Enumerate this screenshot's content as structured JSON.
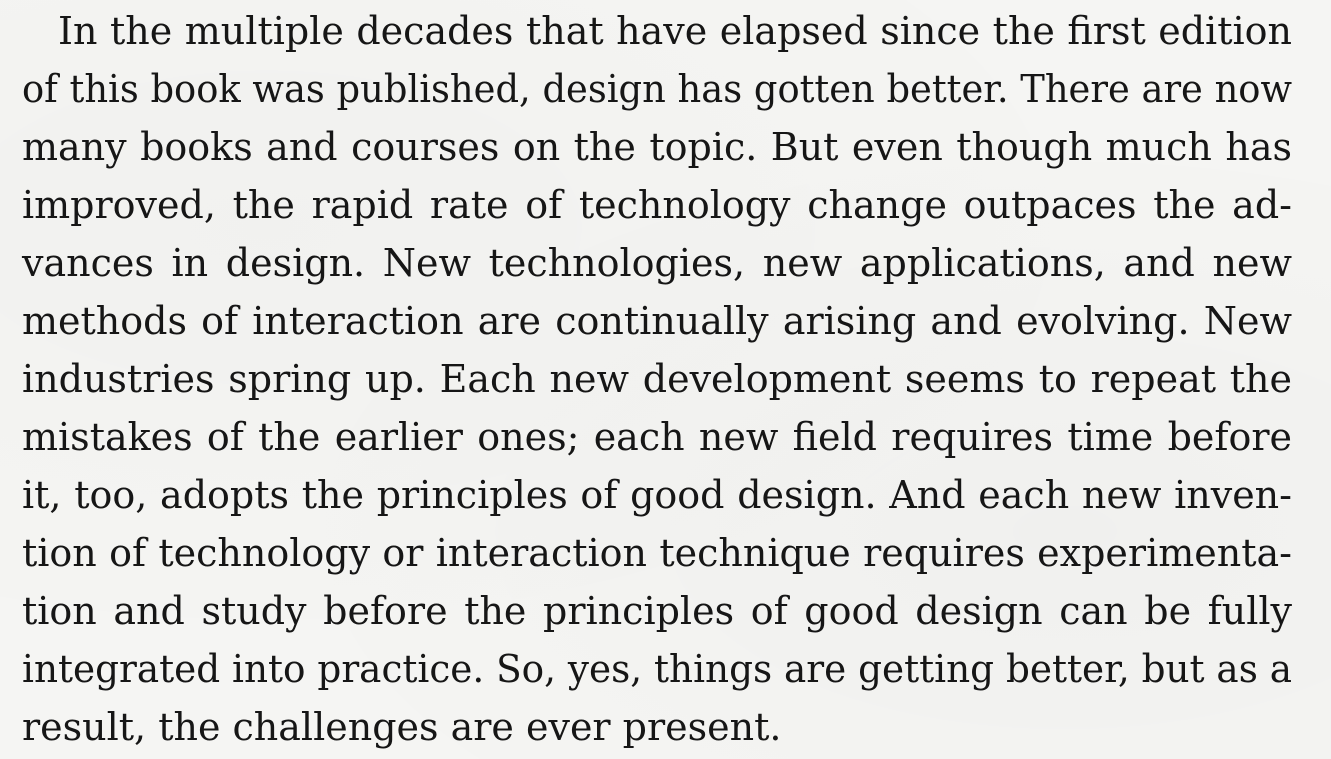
{
  "paragraph": {
    "lines": [
      "In the multiple decades that have elapsed since the first edition",
      "of this book was published, design has gotten better. There are now",
      "many books and courses on the topic. But even though much has",
      "improved, the rapid rate of technology change outpaces the ad-",
      "vances in design. New technologies, new applications, and new",
      "methods of interaction are continually arising and evolving. New",
      "industries spring up. Each new development seems to repeat the",
      "mistakes of the earlier ones; each new field requires time before",
      "it, too, adopts the principles of good design. And each new inven-",
      "tion of technology or interaction technique requires experimenta-",
      "tion and study before the principles of good design can be fully",
      "integrated into practice. So, yes, things are getting better, but as a",
      "result, the challenges are ever present."
    ]
  }
}
